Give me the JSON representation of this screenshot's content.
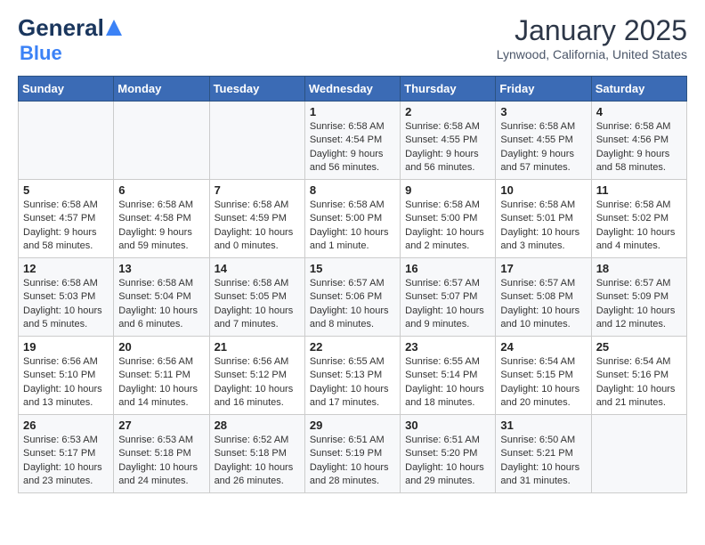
{
  "header": {
    "logo_general": "General",
    "logo_blue": "Blue",
    "month_title": "January 2025",
    "location": "Lynwood, California, United States"
  },
  "days_of_week": [
    "Sunday",
    "Monday",
    "Tuesday",
    "Wednesday",
    "Thursday",
    "Friday",
    "Saturday"
  ],
  "weeks": [
    [
      {
        "day": "",
        "info": ""
      },
      {
        "day": "",
        "info": ""
      },
      {
        "day": "",
        "info": ""
      },
      {
        "day": "1",
        "info": "Sunrise: 6:58 AM\nSunset: 4:54 PM\nDaylight: 9 hours\nand 56 minutes."
      },
      {
        "day": "2",
        "info": "Sunrise: 6:58 AM\nSunset: 4:55 PM\nDaylight: 9 hours\nand 56 minutes."
      },
      {
        "day": "3",
        "info": "Sunrise: 6:58 AM\nSunset: 4:55 PM\nDaylight: 9 hours\nand 57 minutes."
      },
      {
        "day": "4",
        "info": "Sunrise: 6:58 AM\nSunset: 4:56 PM\nDaylight: 9 hours\nand 58 minutes."
      }
    ],
    [
      {
        "day": "5",
        "info": "Sunrise: 6:58 AM\nSunset: 4:57 PM\nDaylight: 9 hours\nand 58 minutes."
      },
      {
        "day": "6",
        "info": "Sunrise: 6:58 AM\nSunset: 4:58 PM\nDaylight: 9 hours\nand 59 minutes."
      },
      {
        "day": "7",
        "info": "Sunrise: 6:58 AM\nSunset: 4:59 PM\nDaylight: 10 hours\nand 0 minutes."
      },
      {
        "day": "8",
        "info": "Sunrise: 6:58 AM\nSunset: 5:00 PM\nDaylight: 10 hours\nand 1 minute."
      },
      {
        "day": "9",
        "info": "Sunrise: 6:58 AM\nSunset: 5:00 PM\nDaylight: 10 hours\nand 2 minutes."
      },
      {
        "day": "10",
        "info": "Sunrise: 6:58 AM\nSunset: 5:01 PM\nDaylight: 10 hours\nand 3 minutes."
      },
      {
        "day": "11",
        "info": "Sunrise: 6:58 AM\nSunset: 5:02 PM\nDaylight: 10 hours\nand 4 minutes."
      }
    ],
    [
      {
        "day": "12",
        "info": "Sunrise: 6:58 AM\nSunset: 5:03 PM\nDaylight: 10 hours\nand 5 minutes."
      },
      {
        "day": "13",
        "info": "Sunrise: 6:58 AM\nSunset: 5:04 PM\nDaylight: 10 hours\nand 6 minutes."
      },
      {
        "day": "14",
        "info": "Sunrise: 6:58 AM\nSunset: 5:05 PM\nDaylight: 10 hours\nand 7 minutes."
      },
      {
        "day": "15",
        "info": "Sunrise: 6:57 AM\nSunset: 5:06 PM\nDaylight: 10 hours\nand 8 minutes."
      },
      {
        "day": "16",
        "info": "Sunrise: 6:57 AM\nSunset: 5:07 PM\nDaylight: 10 hours\nand 9 minutes."
      },
      {
        "day": "17",
        "info": "Sunrise: 6:57 AM\nSunset: 5:08 PM\nDaylight: 10 hours\nand 10 minutes."
      },
      {
        "day": "18",
        "info": "Sunrise: 6:57 AM\nSunset: 5:09 PM\nDaylight: 10 hours\nand 12 minutes."
      }
    ],
    [
      {
        "day": "19",
        "info": "Sunrise: 6:56 AM\nSunset: 5:10 PM\nDaylight: 10 hours\nand 13 minutes."
      },
      {
        "day": "20",
        "info": "Sunrise: 6:56 AM\nSunset: 5:11 PM\nDaylight: 10 hours\nand 14 minutes."
      },
      {
        "day": "21",
        "info": "Sunrise: 6:56 AM\nSunset: 5:12 PM\nDaylight: 10 hours\nand 16 minutes."
      },
      {
        "day": "22",
        "info": "Sunrise: 6:55 AM\nSunset: 5:13 PM\nDaylight: 10 hours\nand 17 minutes."
      },
      {
        "day": "23",
        "info": "Sunrise: 6:55 AM\nSunset: 5:14 PM\nDaylight: 10 hours\nand 18 minutes."
      },
      {
        "day": "24",
        "info": "Sunrise: 6:54 AM\nSunset: 5:15 PM\nDaylight: 10 hours\nand 20 minutes."
      },
      {
        "day": "25",
        "info": "Sunrise: 6:54 AM\nSunset: 5:16 PM\nDaylight: 10 hours\nand 21 minutes."
      }
    ],
    [
      {
        "day": "26",
        "info": "Sunrise: 6:53 AM\nSunset: 5:17 PM\nDaylight: 10 hours\nand 23 minutes."
      },
      {
        "day": "27",
        "info": "Sunrise: 6:53 AM\nSunset: 5:18 PM\nDaylight: 10 hours\nand 24 minutes."
      },
      {
        "day": "28",
        "info": "Sunrise: 6:52 AM\nSunset: 5:18 PM\nDaylight: 10 hours\nand 26 minutes."
      },
      {
        "day": "29",
        "info": "Sunrise: 6:51 AM\nSunset: 5:19 PM\nDaylight: 10 hours\nand 28 minutes."
      },
      {
        "day": "30",
        "info": "Sunrise: 6:51 AM\nSunset: 5:20 PM\nDaylight: 10 hours\nand 29 minutes."
      },
      {
        "day": "31",
        "info": "Sunrise: 6:50 AM\nSunset: 5:21 PM\nDaylight: 10 hours\nand 31 minutes."
      },
      {
        "day": "",
        "info": ""
      }
    ]
  ]
}
